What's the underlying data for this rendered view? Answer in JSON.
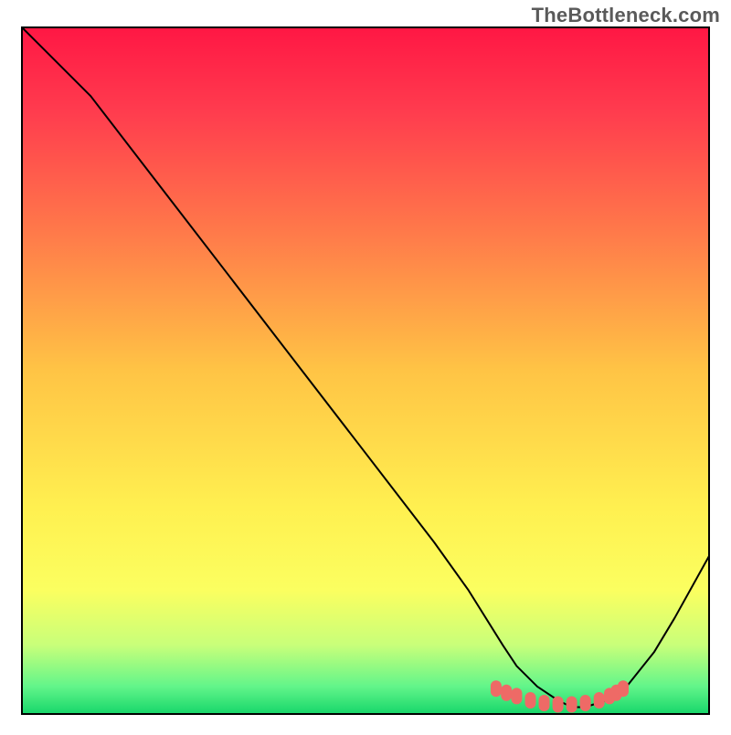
{
  "watermark": "TheBottleneck.com",
  "chart_data": {
    "type": "line",
    "title": "",
    "xlabel": "",
    "ylabel": "",
    "xlim": [
      0,
      100
    ],
    "ylim": [
      0,
      100
    ],
    "grid": false,
    "legend": false,
    "x": [
      0,
      3,
      10,
      20,
      30,
      40,
      50,
      60,
      65,
      70,
      72,
      75,
      78,
      80,
      82,
      85,
      88,
      92,
      95,
      100
    ],
    "values": [
      100,
      97,
      90,
      77,
      64,
      51,
      38,
      25,
      18,
      10,
      7,
      4,
      2,
      1,
      1,
      2,
      4,
      9,
      14,
      23
    ],
    "markers": {
      "x": [
        69,
        70.5,
        72,
        74,
        76,
        78,
        80,
        82,
        84,
        85.5,
        86.5,
        87.5
      ],
      "y": [
        3.7,
        3.1,
        2.6,
        2.0,
        1.6,
        1.4,
        1.4,
        1.6,
        2.0,
        2.6,
        3.1,
        3.7
      ],
      "style": "lozenge",
      "color": "#ee6a66"
    },
    "background": {
      "type": "vertical-gradient",
      "stops": [
        {
          "pos": 0.0,
          "color": "#ff1744"
        },
        {
          "pos": 0.12,
          "color": "#ff3b4e"
        },
        {
          "pos": 0.3,
          "color": "#ff7a4a"
        },
        {
          "pos": 0.5,
          "color": "#ffc445"
        },
        {
          "pos": 0.7,
          "color": "#fff050"
        },
        {
          "pos": 0.82,
          "color": "#fbff60"
        },
        {
          "pos": 0.9,
          "color": "#c8ff7a"
        },
        {
          "pos": 0.96,
          "color": "#62f58a"
        },
        {
          "pos": 1.0,
          "color": "#17d66a"
        }
      ]
    },
    "frame_color": "#000000",
    "line_color": "#000000"
  }
}
